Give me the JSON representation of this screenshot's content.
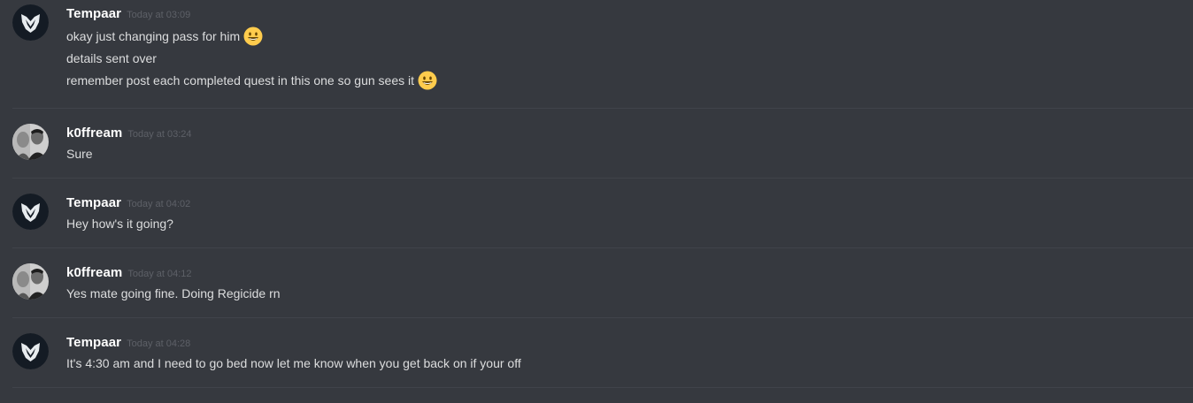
{
  "messages": [
    {
      "author": "Tempaar",
      "avatar": "wolf-logo-icon",
      "timestamp": "Today at 03:09",
      "lines": [
        {
          "text": "okay just changing pass for him",
          "emoji": "smiley-emoji"
        },
        {
          "text": "details sent over"
        },
        {
          "text": "remember post each completed quest in this one so gun sees it",
          "emoji": "smiley-emoji"
        }
      ]
    },
    {
      "author": "k0ffream",
      "avatar": "profile-photo",
      "timestamp": "Today at 03:24",
      "lines": [
        {
          "text": "Sure"
        }
      ]
    },
    {
      "author": "Tempaar",
      "avatar": "wolf-logo-icon",
      "timestamp": "Today at 04:02",
      "lines": [
        {
          "text": "Hey how's it going?"
        }
      ]
    },
    {
      "author": "k0ffream",
      "avatar": "profile-photo",
      "timestamp": "Today at 04:12",
      "lines": [
        {
          "text": "Yes mate going fine. Doing Regicide rn"
        }
      ]
    },
    {
      "author": "Tempaar",
      "avatar": "wolf-logo-icon",
      "timestamp": "Today at 04:28",
      "lines": [
        {
          "text": "It's 4:30 am and I need to go bed now let me know when you get back on if your off"
        }
      ]
    }
  ],
  "colors": {
    "background": "#36393f",
    "username": "#ffffff",
    "timestamp": "#5d6067",
    "message_text": "#dcddde",
    "divider": "#40434a",
    "emoji_yellow": "#ffcc4d"
  }
}
